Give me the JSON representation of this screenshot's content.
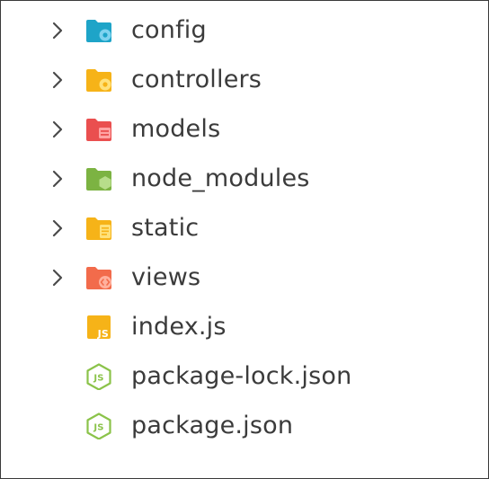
{
  "explorer": {
    "items": [
      {
        "label": "config",
        "kind": "folder",
        "icon": "config-folder-icon",
        "color": "#1ea4c8",
        "badge_color": "#7fd3ef"
      },
      {
        "label": "controllers",
        "kind": "folder",
        "icon": "controllers-folder-icon",
        "color": "#f6b318",
        "badge_color": "#ffe17a"
      },
      {
        "label": "models",
        "kind": "folder",
        "icon": "models-folder-icon",
        "color": "#ea4f4f",
        "badge_color": "#ffa3a3"
      },
      {
        "label": "node_modules",
        "kind": "folder",
        "icon": "node-modules-folder-icon",
        "color": "#7cb342",
        "badge_color": "#b7dd8a"
      },
      {
        "label": "static",
        "kind": "folder",
        "icon": "static-folder-icon",
        "color": "#f6b318",
        "badge_color": "#ffe17a"
      },
      {
        "label": "views",
        "kind": "folder",
        "icon": "views-folder-icon",
        "color": "#f26b4b",
        "badge_color": "#ffb09d"
      },
      {
        "label": "index.js",
        "kind": "js",
        "icon": "javascript-file-icon",
        "color": "#f6b318",
        "icon_text": "JS"
      },
      {
        "label": "package-lock.json",
        "kind": "node",
        "icon": "nodejs-file-icon",
        "color": "#8bc34a",
        "icon_text": "JS"
      },
      {
        "label": "package.json",
        "kind": "node",
        "icon": "nodejs-file-icon",
        "color": "#8bc34a",
        "icon_text": "JS"
      }
    ]
  }
}
